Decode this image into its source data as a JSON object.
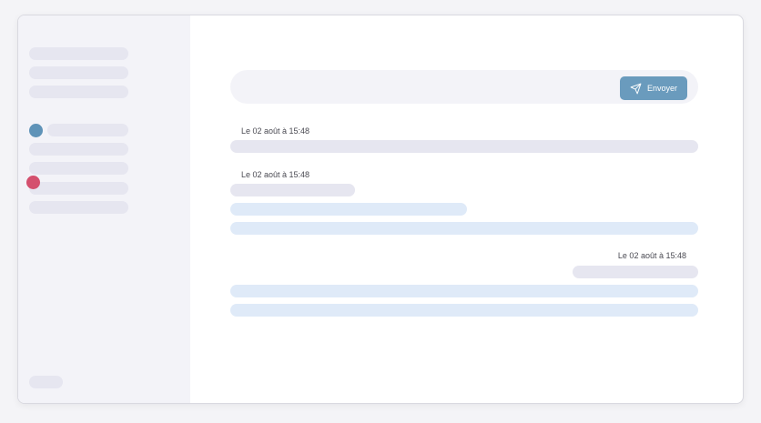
{
  "composer": {
    "send_label": "Envoyer",
    "send_icon": "paper-plane-icon"
  },
  "messages": [
    {
      "timestamp": "Le 02 août à 15:48"
    },
    {
      "timestamp": "Le 02 août à 15:48"
    },
    {
      "timestamp": "Le 02 août à 15:48"
    }
  ],
  "colors": {
    "accent": "#6a9bbd",
    "status_blue": "#5f93b8",
    "status_red": "#d4506e",
    "skeleton": "#e6e6f0",
    "bubble": "#dfeaf8"
  }
}
